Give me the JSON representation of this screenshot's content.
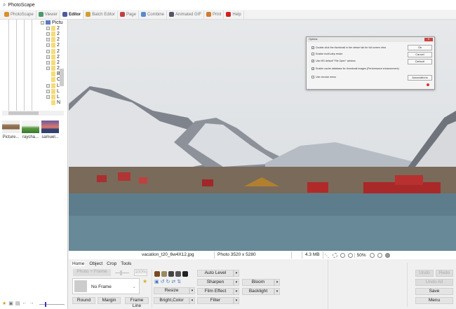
{
  "app": {
    "title": "PhotoScape"
  },
  "tabs": [
    {
      "label": "PhotoScape",
      "color": "#d9902a"
    },
    {
      "label": "Viewer",
      "color": "#4a9a6a"
    },
    {
      "label": "Editor",
      "color": "#4a5aa0",
      "active": true
    },
    {
      "label": "Batch Editor",
      "color": "#d0a030"
    },
    {
      "label": "Page",
      "color": "#c04040"
    },
    {
      "label": "Combine",
      "color": "#5a8ad0"
    },
    {
      "label": "Animated GIF",
      "color": "#556"
    },
    {
      "label": "Print",
      "color": "#d07a30"
    },
    {
      "label": "Help",
      "color": "#d02020"
    }
  ],
  "tree": {
    "root": "Pictu",
    "items": [
      "2",
      "2",
      "2",
      "2",
      "2",
      "2",
      "2",
      "2",
      "B",
      "C",
      "L",
      "L",
      "L",
      "N"
    ]
  },
  "thumbnails": [
    "Picture...",
    "raycha...",
    "samuel..."
  ],
  "dialog": {
    "title": "Options",
    "options": [
      {
        "label": "Double-click the thumbnail in the viewer tab for full screen view",
        "checked": true
      },
      {
        "label": "Enable multi-step resize",
        "checked": false
      },
      {
        "label": "Use MS default \"File Open\" window",
        "checked": true
      },
      {
        "label": "Enable cache database for thumbnail images (Performance enhancement)",
        "checked": true
      },
      {
        "label": "Use circular menu",
        "checked": false
      }
    ],
    "buttons": {
      "ok": "Ok",
      "cancel": "Cancel",
      "default": "Default",
      "associations": "Associations"
    }
  },
  "status": {
    "filename": "vacation_t20_6w4X12.jpg",
    "dimensions": "Photo 3520 x 5280",
    "filesize": "4.3 MB",
    "zoom": "50%"
  },
  "editor": {
    "tabs": [
      "Home",
      "Object",
      "Crop",
      "Tools"
    ],
    "photo_frame": "Photo + Frame",
    "opacity": "100%",
    "frame_select": "No Frame",
    "round": "Round",
    "margin": "Margin",
    "frame_line": "Frame Line",
    "resize": "Resize",
    "bright_color": "Bright,Color",
    "auto_level": "Auto Level",
    "sharpen": "Sharpen",
    "film_effect": "Film Effect",
    "filter": "Filter",
    "bloom": "Bloom",
    "backlight": "Backlight",
    "undo": "Undo",
    "redo": "Redo",
    "undo_all": "Undo All",
    "save": "Save",
    "menu": "Menu"
  }
}
